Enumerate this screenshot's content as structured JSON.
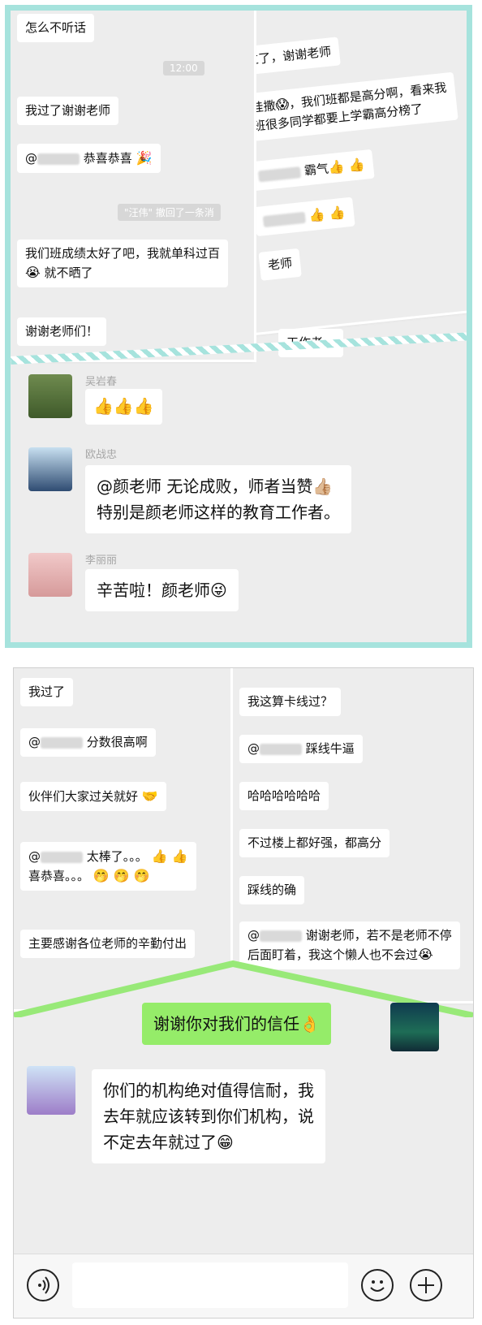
{
  "top_collage": {
    "left_shot": {
      "messages": [
        {
          "text": "怎么不听话"
        },
        {
          "text": "12:00",
          "kind": "time"
        },
        {
          "text": "我过了谢谢老师"
        },
        {
          "text": "恭喜恭喜",
          "prefix": "@",
          "emoji": "🎉"
        },
        {
          "text": "\"汪伟\" 撤回了一条消",
          "kind": "system"
        },
        {
          "text": "我们班成绩太好了吧，我就单科过百"
        },
        {
          "text": "就不晒了",
          "emoji": "😭"
        },
        {
          "text": "谢谢老师们！"
        }
      ]
    },
    "right_shot": {
      "messages": [
        {
          "text": "过了，谢谢老师"
        },
        {
          "text": "哇撒",
          "emoji": "😱"
        },
        {
          "text": "，我们班都是高分啊，看来我"
        },
        {
          "text": "班很多同学都要上学霸高分榜了"
        },
        {
          "text": "霸气",
          "emoji": "👍 👍"
        },
        {
          "text": "👍 👍"
        },
        {
          "text": "老师"
        },
        {
          "text": "工作者。"
        }
      ]
    },
    "chat": [
      {
        "nick": "吴岩春",
        "text": "👍👍👍"
      },
      {
        "nick": "欧战忠",
        "line1": "@颜老师  无论成败，师者当赞👍🏼",
        "line2": "特别是颜老师这样的教育工作者。"
      },
      {
        "nick": "李丽丽",
        "text": "辛苦啦！颜老师😜"
      }
    ]
  },
  "bottom_collage": {
    "left_shot": {
      "messages": [
        {
          "text": "我过了"
        },
        {
          "text": "分数很高啊",
          "prefix": "@"
        },
        {
          "text": "伙伴们大家过关就好",
          "emoji": "🤝"
        },
        {
          "text": "太棒了。。。",
          "prefix": "@",
          "emoji": "👍 👍"
        },
        {
          "text": "喜恭喜。。。",
          "emoji": "🤭 🤭 🤭"
        },
        {
          "text": "主要感谢各位老师的辛勤付出"
        }
      ]
    },
    "right_shot": {
      "messages": [
        {
          "text": "我这算卡线过？"
        },
        {
          "text": "踩线",
          "prefix": "@",
          "suffix": "牛逼"
        },
        {
          "text": "哈哈哈哈哈哈"
        },
        {
          "text": "不过楼上都好强，都高分"
        },
        {
          "text": "踩线的确"
        },
        {
          "text": "谢谢老师，若不是老师不停",
          "prefix": "@"
        },
        {
          "text": "后面盯着，我这个懒人也不会过",
          "emoji": "😭"
        }
      ]
    },
    "chat": {
      "sent": "谢谢你对我们的信任👌",
      "received_lines": [
        "你们的机构绝对值得信耐，我",
        "去年就应该转到你们机构，说",
        "不定去年就过了😁"
      ]
    },
    "input_bar": {
      "voice_icon": "voice-icon",
      "emoji_icon": "emoji-icon",
      "plus_icon": "plus-icon"
    }
  }
}
